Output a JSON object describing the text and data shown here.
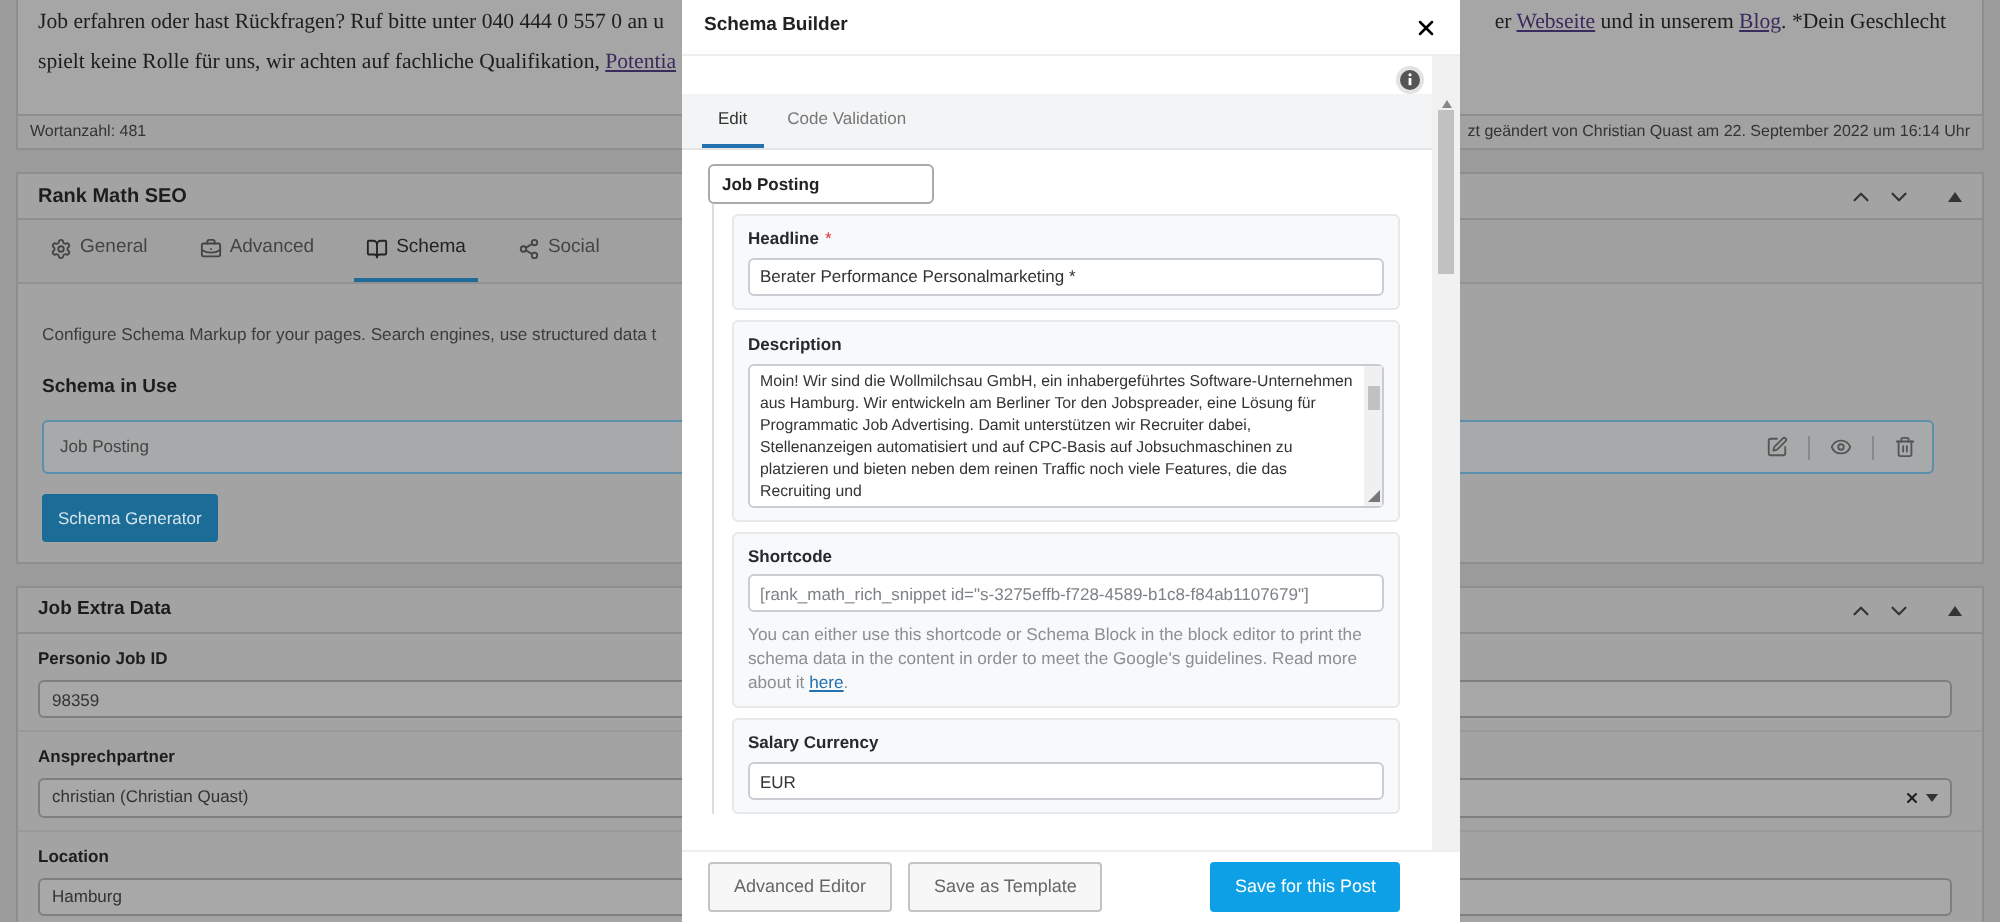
{
  "background_editor": {
    "lines": [
      {
        "left": [
          {
            "kind": "text",
            "text": "Job erfahren oder hast Rückfragen? Ruf bitte unter 040 444 0 557 0 an u"
          }
        ],
        "right": [
          {
            "kind": "text",
            "text": "er "
          },
          {
            "kind": "link",
            "text": "Webseite"
          },
          {
            "kind": "text",
            "text": " und in unserem "
          },
          {
            "kind": "link",
            "text": "Blog"
          },
          {
            "kind": "text",
            "text": ". *Dein Geschlecht"
          }
        ]
      },
      {
        "left": [
          {
            "kind": "text",
            "text": "spielt keine Rolle für uns, wir achten auf fachliche Qualifikation, "
          },
          {
            "kind": "link",
            "text": "Potentia"
          }
        ]
      }
    ],
    "word_count": "Wortanzahl: 481",
    "last_edited": "zt geändert von Christian Quast am 22. September 2022 um 16:14 Uhr"
  },
  "rank_math": {
    "title": "Rank Math SEO",
    "tabs": [
      {
        "label": "General",
        "selected": false
      },
      {
        "label": "Advanced",
        "selected": false
      },
      {
        "label": "Schema",
        "selected": true
      },
      {
        "label": "Social",
        "selected": false
      }
    ],
    "description": "Configure Schema Markup for your pages. Search engines, use structured data t",
    "schema_heading": "Schema in Use",
    "schema_item": "Job Posting",
    "generator_button": "Schema Generator"
  },
  "job_extra_data": {
    "title": "Job Extra Data",
    "fields": [
      {
        "kind": "input",
        "label": "Personio Job ID",
        "value": "98359"
      },
      {
        "kind": "select",
        "label": "Ansprechpartner",
        "value": "christian (Christian Quast)"
      },
      {
        "kind": "input",
        "label": "Location",
        "value": "Hamburg"
      }
    ]
  },
  "schema_builder": {
    "title": "Schema Builder",
    "tabs": [
      {
        "label": "Edit",
        "selected": true
      },
      {
        "label": "Code Validation",
        "selected": false
      }
    ],
    "schema_type": "Job Posting",
    "fields": [
      {
        "kind": "input",
        "label": "Headline",
        "required_mark": "*",
        "value": "Berater Performance Personalmarketing *"
      },
      {
        "kind": "textarea",
        "label": "Description",
        "value": "Moin! Wir sind die Wollmilchsau GmbH, ein inhabergeführtes Software-Unternehmen aus Hamburg. Wir entwickeln am Berliner Tor den Jobspreader, eine Lösung für Programmatic Job Advertising. Damit unterstützen wir Recruiter dabei, Stellenanzeigen automatisiert und auf CPC-Basis auf Jobsuchmaschinen zu platzieren und bieten neben dem reinen Traffic noch viele Features, die das Recruiting und"
      },
      {
        "kind": "shortcode",
        "label": "Shortcode",
        "value": "[rank_math_rich_snippet id=\"s-3275effb-f728-4589-b1c8-f84ab1107679\"]",
        "help": "You can either use this shortcode or Schema Block in the block editor to print the schema data in the content in order to meet the Google's guidelines. Read more about it",
        "help_link": "here",
        "help_end": "."
      },
      {
        "kind": "input",
        "label": "Salary Currency",
        "value": "EUR"
      }
    ],
    "buttons": [
      {
        "kind": "secondary",
        "label": "Advanced Editor"
      },
      {
        "kind": "secondary",
        "label": "Save as Template"
      },
      {
        "kind": "primary",
        "label": "Save for this Post"
      }
    ]
  }
}
